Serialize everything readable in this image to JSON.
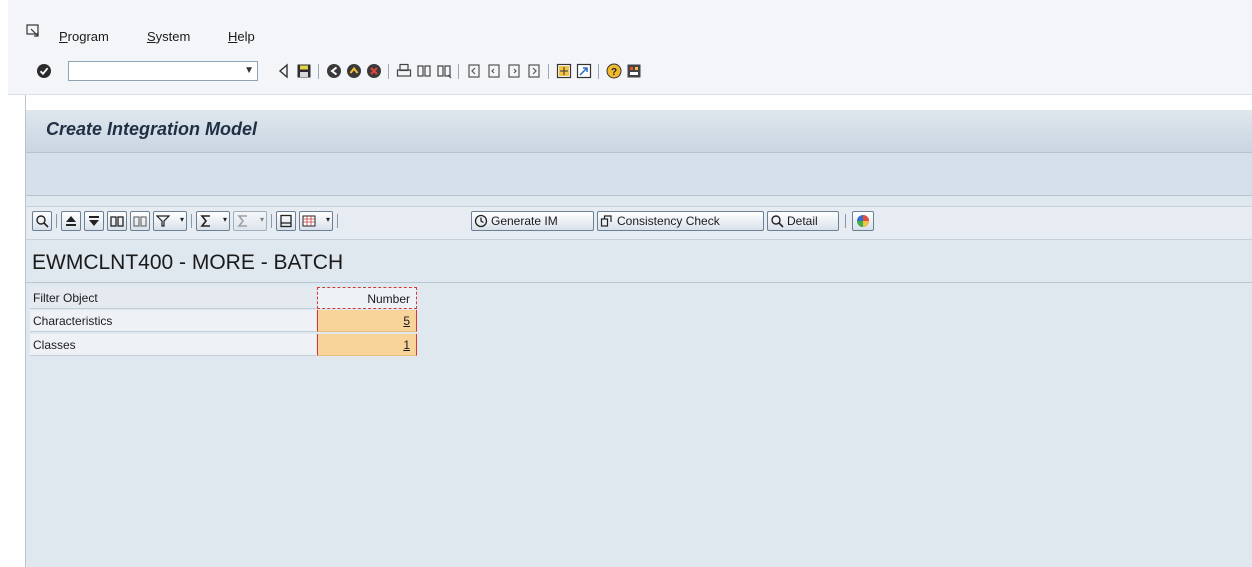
{
  "menu": {
    "items": [
      {
        "label": "Program"
      },
      {
        "label": "System"
      },
      {
        "label": "Help"
      }
    ]
  },
  "toolbar": {
    "command_field_value": "",
    "icons": [
      "enter-icon",
      "back-triangle-icon",
      "save-icon",
      "back-icon",
      "exit-icon",
      "cancel-icon",
      "print-icon",
      "find-icon",
      "find-next-icon",
      "first-page-icon",
      "previous-page-icon",
      "next-page-icon",
      "last-page-icon",
      "new-session-icon",
      "shortcut-icon",
      "help-icon",
      "layout-menu-icon"
    ]
  },
  "screen": {
    "title": "Create Integration Model"
  },
  "alv_toolbar": {
    "generate_label": "Generate IM",
    "consistency_label": "Consistency Check",
    "detail_label": "Detail"
  },
  "list": {
    "heading": "EWMCLNT400 - MORE - BATCH",
    "columns": [
      "Filter Object",
      "Number"
    ],
    "rows": [
      {
        "object": "Characteristics",
        "number": "5"
      },
      {
        "object": "Classes",
        "number": "1"
      }
    ]
  },
  "colors": {
    "accent_orange": "#f9d49a",
    "highlight_red": "#d23a3a",
    "background": "#dfe7ef"
  }
}
